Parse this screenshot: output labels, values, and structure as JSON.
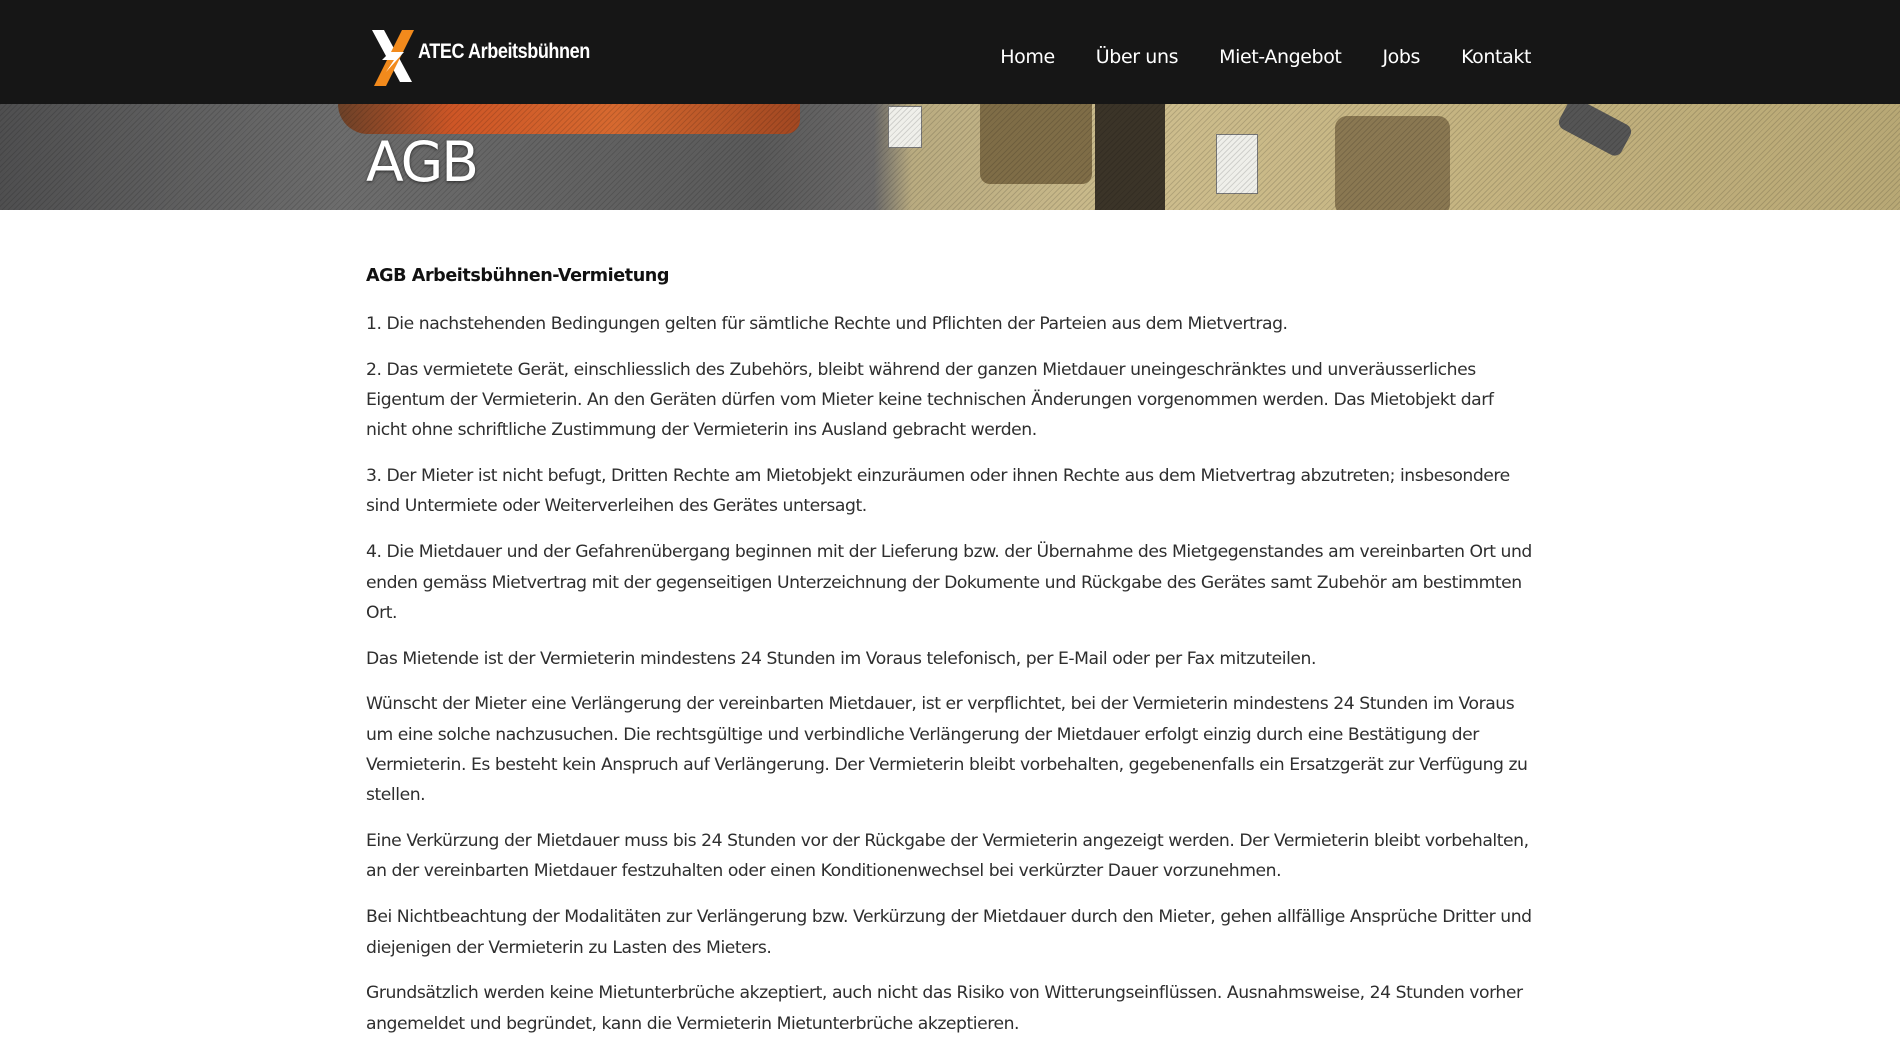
{
  "header": {
    "brand": "ATEC Arbeitsbühnen",
    "logo_icon": "x-lightning-logo",
    "nav": [
      "Home",
      "Über uns",
      "Miet-Angebot",
      "Jobs",
      "Kontakt"
    ]
  },
  "banner": {
    "title": "AGB"
  },
  "content": {
    "heading": "AGB Arbeitsbühnen-Vermietung",
    "paragraphs": [
      "1. Die nachstehenden Bedingungen gelten für sämtliche Rechte und Pflichten der Parteien aus dem Mietvertrag.",
      "2. Das vermietete Gerät, einschliesslich des Zubehörs, bleibt während der ganzen Mietdauer uneingeschränktes und unveräusserliches Eigentum der Vermieterin. An den Geräten dürfen vom Mieter keine technischen Änderungen vorgenommen werden. Das Mietobjekt darf nicht ohne schriftliche Zustimmung der Vermieterin ins Ausland gebracht werden.",
      "3. Der Mieter ist nicht befugt, Dritten Rechte am Mietobjekt einzuräumen oder ihnen Rechte aus dem Mietvertrag abzutreten; insbesondere sind Untermiete oder Weiterverleihen des Gerätes untersagt.",
      "4. Die Mietdauer und der Gefahrenübergang beginnen mit der Lieferung bzw. der Übernahme des Mietgegenstandes am vereinbarten Ort und enden gemäss Mietvertrag mit der gegenseitigen Unterzeichnung der Dokumente und Rückgabe des Gerätes samt Zubehör am bestimmten Ort.",
      "Das Mietende ist der Vermieterin mindestens 24 Stunden im Voraus telefonisch, per E-Mail oder per Fax mitzuteilen.",
      "Wünscht der Mieter eine Verlängerung der vereinbarten Mietdauer, ist er verpflichtet, bei der Vermieterin mindestens 24 Stunden im Voraus um eine solche nachzusuchen. Die rechtsgültige und verbindliche Verlängerung der Mietdauer erfolgt einzig durch eine Bestätigung der Vermieterin. Es besteht kein Anspruch auf Verlängerung. Der Vermieterin bleibt vorbehalten, gegebenenfalls ein Ersatzgerät zur Verfügung zu stellen.",
      "Eine Verkürzung der Mietdauer muss bis 24 Stunden vor der Rückgabe der Vermieterin angezeigt werden. Der Vermieterin bleibt vorbehalten, an der vereinbarten Mietdauer festzuhalten oder einen Konditionenwechsel bei verkürzter Dauer vorzunehmen.",
      "Bei Nichtbeachtung der Modalitäten zur Verlängerung bzw. Verkürzung der Mietdauer durch den Mieter, gehen allfällige Ansprüche Dritter und diejenigen der Vermieterin zu Lasten des Mieters.",
      "Grundsätzlich werden keine Mietunterbrüche akzeptiert, auch nicht das Risiko von Witterungseinflüssen. Ausnahmsweise, 24 Stunden vorher angemeldet und begründet, kann die Vermieterin Mietunterbrüche akzeptieren."
    ]
  },
  "colors": {
    "header_bg": "#161616",
    "logo_orange": "#f28a1c",
    "text": "#2e2e2e"
  }
}
